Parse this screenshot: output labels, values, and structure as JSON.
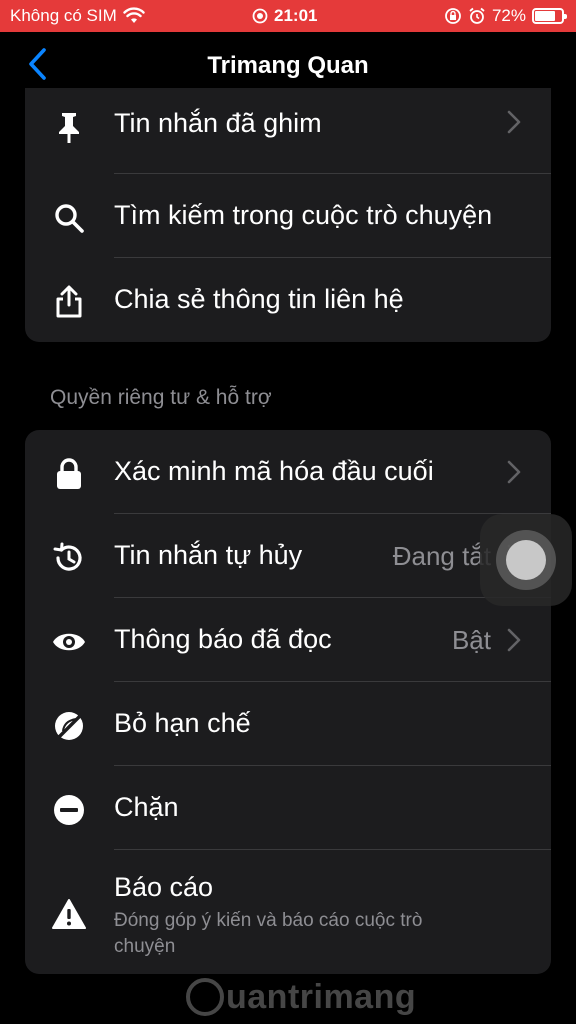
{
  "status_bar": {
    "carrier": "Không có SIM",
    "time": "21:01",
    "battery_percent": "72%",
    "battery_level": 0.72,
    "color": "#e53a3a"
  },
  "nav": {
    "title": "Trimang Quan"
  },
  "group1": {
    "items": [
      {
        "icon": "pin-icon",
        "label": "Tin nhắn đã ghim"
      },
      {
        "icon": "search-icon",
        "label": "Tìm kiếm trong cuộc trò chuyện"
      },
      {
        "icon": "share-icon",
        "label": "Chia sẻ thông tin liên hệ"
      }
    ]
  },
  "section_header": "Quyền riêng tư & hỗ trợ",
  "group2": {
    "items": [
      {
        "icon": "lock-icon",
        "label": "Xác minh mã hóa đầu cuối",
        "value": ""
      },
      {
        "icon": "history-icon",
        "label": "Tin nhắn tự hủy",
        "value": "Đang tắt"
      },
      {
        "icon": "eye-icon",
        "label": "Thông báo đã đọc",
        "value": "Bật"
      },
      {
        "icon": "unrestrict-icon",
        "label": "Bỏ hạn chế",
        "value": ""
      },
      {
        "icon": "block-icon",
        "label": "Chặn",
        "value": ""
      },
      {
        "icon": "warning-icon",
        "label": "Báo cáo",
        "sub": "Đóng góp ý kiến và báo cáo cuộc trò chuyện"
      }
    ]
  },
  "watermark": "uantrimang",
  "colors": {
    "background": "#000000",
    "card": "#1c1c1e",
    "secondary_text": "#8e8e93",
    "accent_blue": "#0a84ff",
    "status_red": "#e53a3a"
  }
}
